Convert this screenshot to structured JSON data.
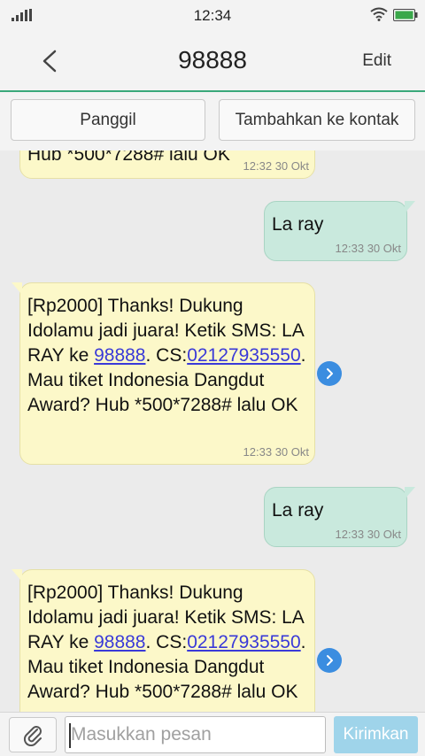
{
  "status_bar": {
    "time": "12:34"
  },
  "header": {
    "title": "98888",
    "edit_label": "Edit"
  },
  "actions": {
    "call_label": "Panggil",
    "add_contact_label": "Tambahkan ke kontak"
  },
  "messages": [
    {
      "direction": "in",
      "text": "Hub *500*7288# lalu OK",
      "time": "12:32 30 Okt"
    },
    {
      "direction": "out",
      "text": "La ray",
      "time": "12:33 30 Okt"
    },
    {
      "direction": "in",
      "text_pre": "[Rp2000] Thanks! Dukung Idolamu jadi juara! Ketik SMS: LA RAY ke ",
      "link_number": "98888",
      "text_mid": ". CS:",
      "link_cs": "02127935550",
      "text_post": ". Mau tiket Indonesia Dangdut Award? Hub *500*7288# lalu OK",
      "time": "12:33 30 Okt"
    },
    {
      "direction": "out",
      "text": "La ray",
      "time": "12:33 30 Okt"
    },
    {
      "direction": "in",
      "text_pre": "[Rp2000] Thanks! Dukung Idolamu jadi juara! Ketik SMS: LA RAY ke ",
      "link_number": "98888",
      "text_mid": ". CS:",
      "link_cs": "02127935550",
      "text_post": ". Mau tiket Indonesia Dangdut Award? Hub *500*7288# lalu OK"
    }
  ],
  "compose": {
    "placeholder": "Masukkan pesan",
    "send_label": "Kirimkan"
  },
  "colors": {
    "accent": "#3aa87a",
    "incoming_bubble": "#fcf8c9",
    "outgoing_bubble": "#c9e9dd",
    "send_button": "#9fd4ea",
    "link": "#3a3ad8"
  },
  "icons": {
    "signal": "signal-icon",
    "wifi": "wifi-icon",
    "battery": "battery-icon",
    "back": "back-chevron-icon",
    "forward": "forward-arrow-icon",
    "attach": "paperclip-icon"
  }
}
